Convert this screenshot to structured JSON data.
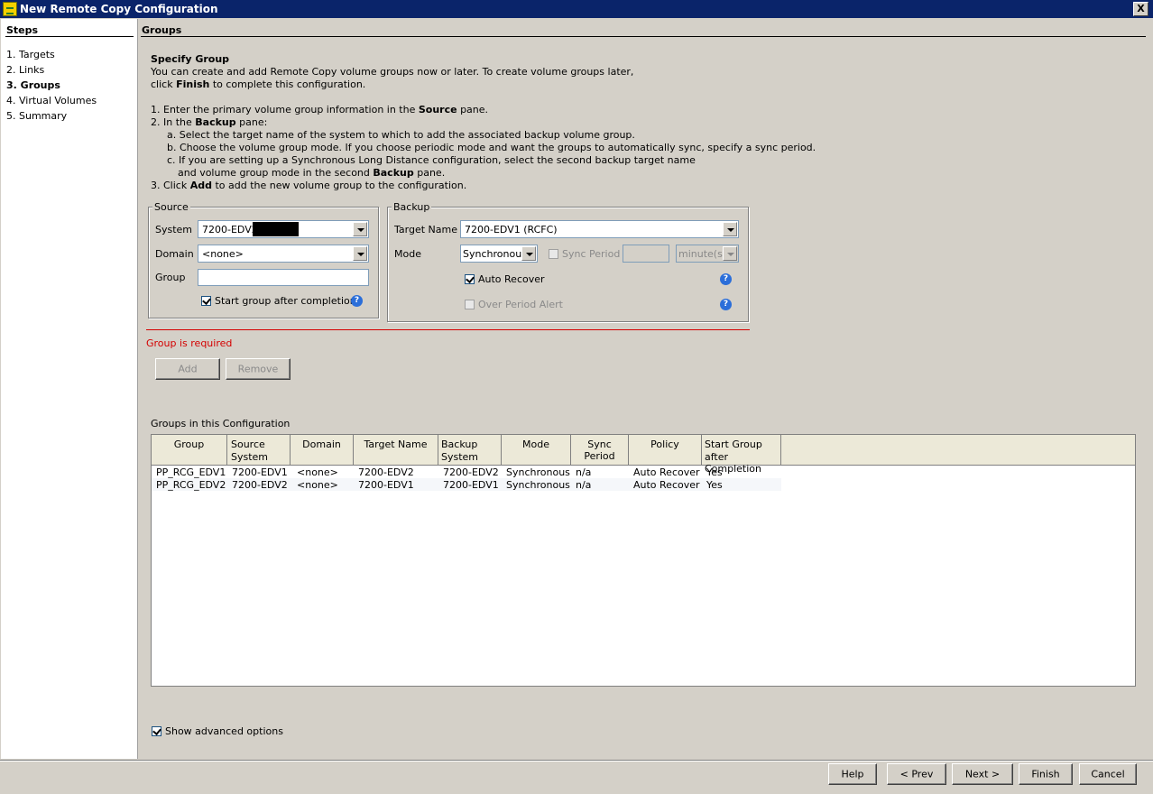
{
  "window": {
    "title": "New Remote Copy Configuration",
    "close_label": "X"
  },
  "steps": {
    "heading": "Steps",
    "items": [
      {
        "label": "1. Targets",
        "current": false
      },
      {
        "label": "2. Links",
        "current": false
      },
      {
        "label": "3. Groups",
        "current": true
      },
      {
        "label": "4. Virtual Volumes",
        "current": false
      },
      {
        "label": "5. Summary",
        "current": false
      }
    ]
  },
  "page": {
    "heading": "Groups"
  },
  "intro": {
    "title": "Specify Group",
    "line1": "You can create and add Remote Copy volume groups now or later. To create volume groups later,",
    "line2_pre": "click ",
    "line2_bold": "Finish",
    "line2_post": " to complete this configuration.",
    "step1_pre": "1. Enter the primary volume group information in the ",
    "step1_bold": "Source",
    "step1_post": " pane.",
    "step2_pre": "2. In the ",
    "step2_bold": "Backup",
    "step2_post": " pane:",
    "step2a": "a. Select the target name of the system to which to add the associated backup volume group.",
    "step2b": "b. Choose the volume group mode. If you choose periodic mode and want the groups to automatically sync, specify a sync period.",
    "step2c1": "c. If you are setting up a Synchronous Long Distance configuration, select the second backup target name",
    "step2c2_pre": "and volume group mode in the second ",
    "step2c2_bold": "Backup",
    "step2c2_post": " pane.",
    "step3_pre": "3. Click ",
    "step3_bold": "Add",
    "step3_post": " to add the new volume group to the configuration."
  },
  "source": {
    "legend": "Source",
    "system_label": "System",
    "system_value": "7200-EDV2",
    "domain_label": "Domain",
    "domain_value": "<none>",
    "group_label": "Group",
    "group_value": "",
    "start_group_label": "Start group after completion",
    "start_group_checked": true
  },
  "backup": {
    "legend": "Backup",
    "target_label": "Target Name",
    "target_value": "7200-EDV1 (RCFC)",
    "mode_label": "Mode",
    "mode_value": "Synchronous",
    "sync_period_label": "Sync Period",
    "sync_period_value": "",
    "sync_unit": "minute(s)",
    "auto_recover_label": "Auto Recover",
    "auto_recover_checked": true,
    "over_period_label": "Over Period Alert",
    "over_period_checked": false
  },
  "validation": {
    "message": "Group is required",
    "color": "#d40000"
  },
  "actions": {
    "add_label": "Add",
    "remove_label": "Remove"
  },
  "groups_table": {
    "caption": "Groups in this Configuration",
    "columns": [
      [
        "Group",
        ""
      ],
      [
        "Source",
        "System"
      ],
      [
        "Domain",
        ""
      ],
      [
        "Target Name",
        ""
      ],
      [
        "Backup",
        "System"
      ],
      [
        "Mode",
        ""
      ],
      [
        "Sync Period",
        ""
      ],
      [
        "Policy",
        ""
      ],
      [
        "Start Group",
        "after Completion"
      ]
    ],
    "rows": [
      [
        "PP_RCG_EDV1",
        "7200-EDV1",
        "<none>",
        "7200-EDV2",
        "7200-EDV2",
        "Synchronous",
        "n/a",
        "Auto Recover",
        "Yes"
      ],
      [
        "PP_RCG_EDV2",
        "7200-EDV2",
        "<none>",
        "7200-EDV1",
        "7200-EDV1",
        "Synchronous",
        "n/a",
        "Auto Recover",
        "Yes"
      ]
    ]
  },
  "advanced": {
    "label": "Show advanced options",
    "checked": true
  },
  "footer": {
    "help_label": "Help",
    "prev_label": "< Prev",
    "next_label": "Next >",
    "finish_label": "Finish",
    "cancel_label": "Cancel"
  }
}
